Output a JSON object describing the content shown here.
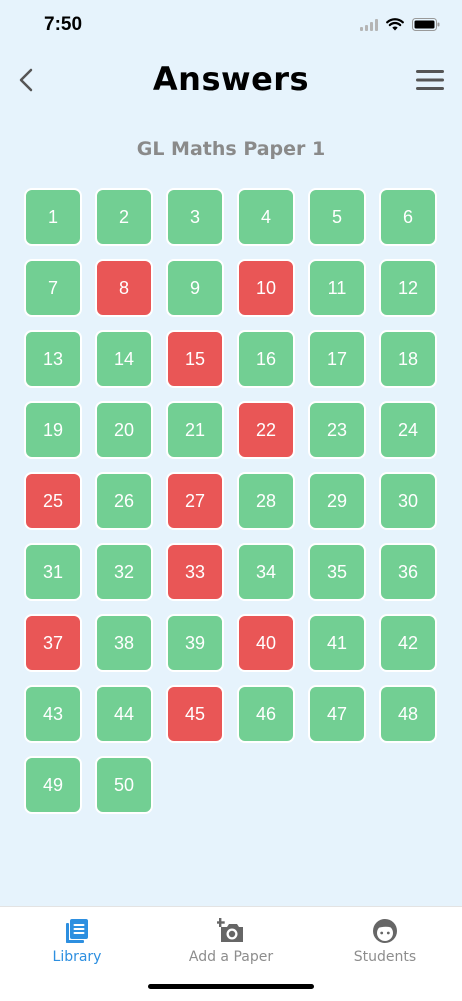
{
  "status_bar": {
    "time": "7:50",
    "icons": [
      "signal-icon",
      "wifi-icon",
      "battery-icon"
    ]
  },
  "header": {
    "title": "Answers",
    "back_icon": "chevron-left-icon",
    "menu_icon": "hamburger-menu-icon"
  },
  "paper": {
    "name": "GL Maths Paper 1"
  },
  "colors": {
    "correct": "#72cf93",
    "wrong": "#e95656",
    "background": "#e6f3fc",
    "accent": "#2d8fe0"
  },
  "answers": [
    {
      "n": "1",
      "status": "correct"
    },
    {
      "n": "2",
      "status": "correct"
    },
    {
      "n": "3",
      "status": "correct"
    },
    {
      "n": "4",
      "status": "correct"
    },
    {
      "n": "5",
      "status": "correct"
    },
    {
      "n": "6",
      "status": "correct"
    },
    {
      "n": "7",
      "status": "correct"
    },
    {
      "n": "8",
      "status": "wrong"
    },
    {
      "n": "9",
      "status": "correct"
    },
    {
      "n": "10",
      "status": "wrong"
    },
    {
      "n": "11",
      "status": "correct"
    },
    {
      "n": "12",
      "status": "correct"
    },
    {
      "n": "13",
      "status": "correct"
    },
    {
      "n": "14",
      "status": "correct"
    },
    {
      "n": "15",
      "status": "wrong"
    },
    {
      "n": "16",
      "status": "correct"
    },
    {
      "n": "17",
      "status": "correct"
    },
    {
      "n": "18",
      "status": "correct"
    },
    {
      "n": "19",
      "status": "correct"
    },
    {
      "n": "20",
      "status": "correct"
    },
    {
      "n": "21",
      "status": "correct"
    },
    {
      "n": "22",
      "status": "wrong"
    },
    {
      "n": "23",
      "status": "correct"
    },
    {
      "n": "24",
      "status": "correct"
    },
    {
      "n": "25",
      "status": "wrong"
    },
    {
      "n": "26",
      "status": "correct"
    },
    {
      "n": "27",
      "status": "wrong"
    },
    {
      "n": "28",
      "status": "correct"
    },
    {
      "n": "29",
      "status": "correct"
    },
    {
      "n": "30",
      "status": "correct"
    },
    {
      "n": "31",
      "status": "correct"
    },
    {
      "n": "32",
      "status": "correct"
    },
    {
      "n": "33",
      "status": "wrong"
    },
    {
      "n": "34",
      "status": "correct"
    },
    {
      "n": "35",
      "status": "correct"
    },
    {
      "n": "36",
      "status": "correct"
    },
    {
      "n": "37",
      "status": "wrong"
    },
    {
      "n": "38",
      "status": "correct"
    },
    {
      "n": "39",
      "status": "correct"
    },
    {
      "n": "40",
      "status": "wrong"
    },
    {
      "n": "41",
      "status": "correct"
    },
    {
      "n": "42",
      "status": "correct"
    },
    {
      "n": "43",
      "status": "correct"
    },
    {
      "n": "44",
      "status": "correct"
    },
    {
      "n": "45",
      "status": "wrong"
    },
    {
      "n": "46",
      "status": "correct"
    },
    {
      "n": "47",
      "status": "correct"
    },
    {
      "n": "48",
      "status": "correct"
    },
    {
      "n": "49",
      "status": "correct"
    },
    {
      "n": "50",
      "status": "correct"
    }
  ],
  "tabbar": {
    "items": [
      {
        "label": "Library",
        "icon": "library-icon",
        "active": true
      },
      {
        "label": "Add a Paper",
        "icon": "add-camera-icon",
        "active": false
      },
      {
        "label": "Students",
        "icon": "student-face-icon",
        "active": false
      }
    ]
  }
}
